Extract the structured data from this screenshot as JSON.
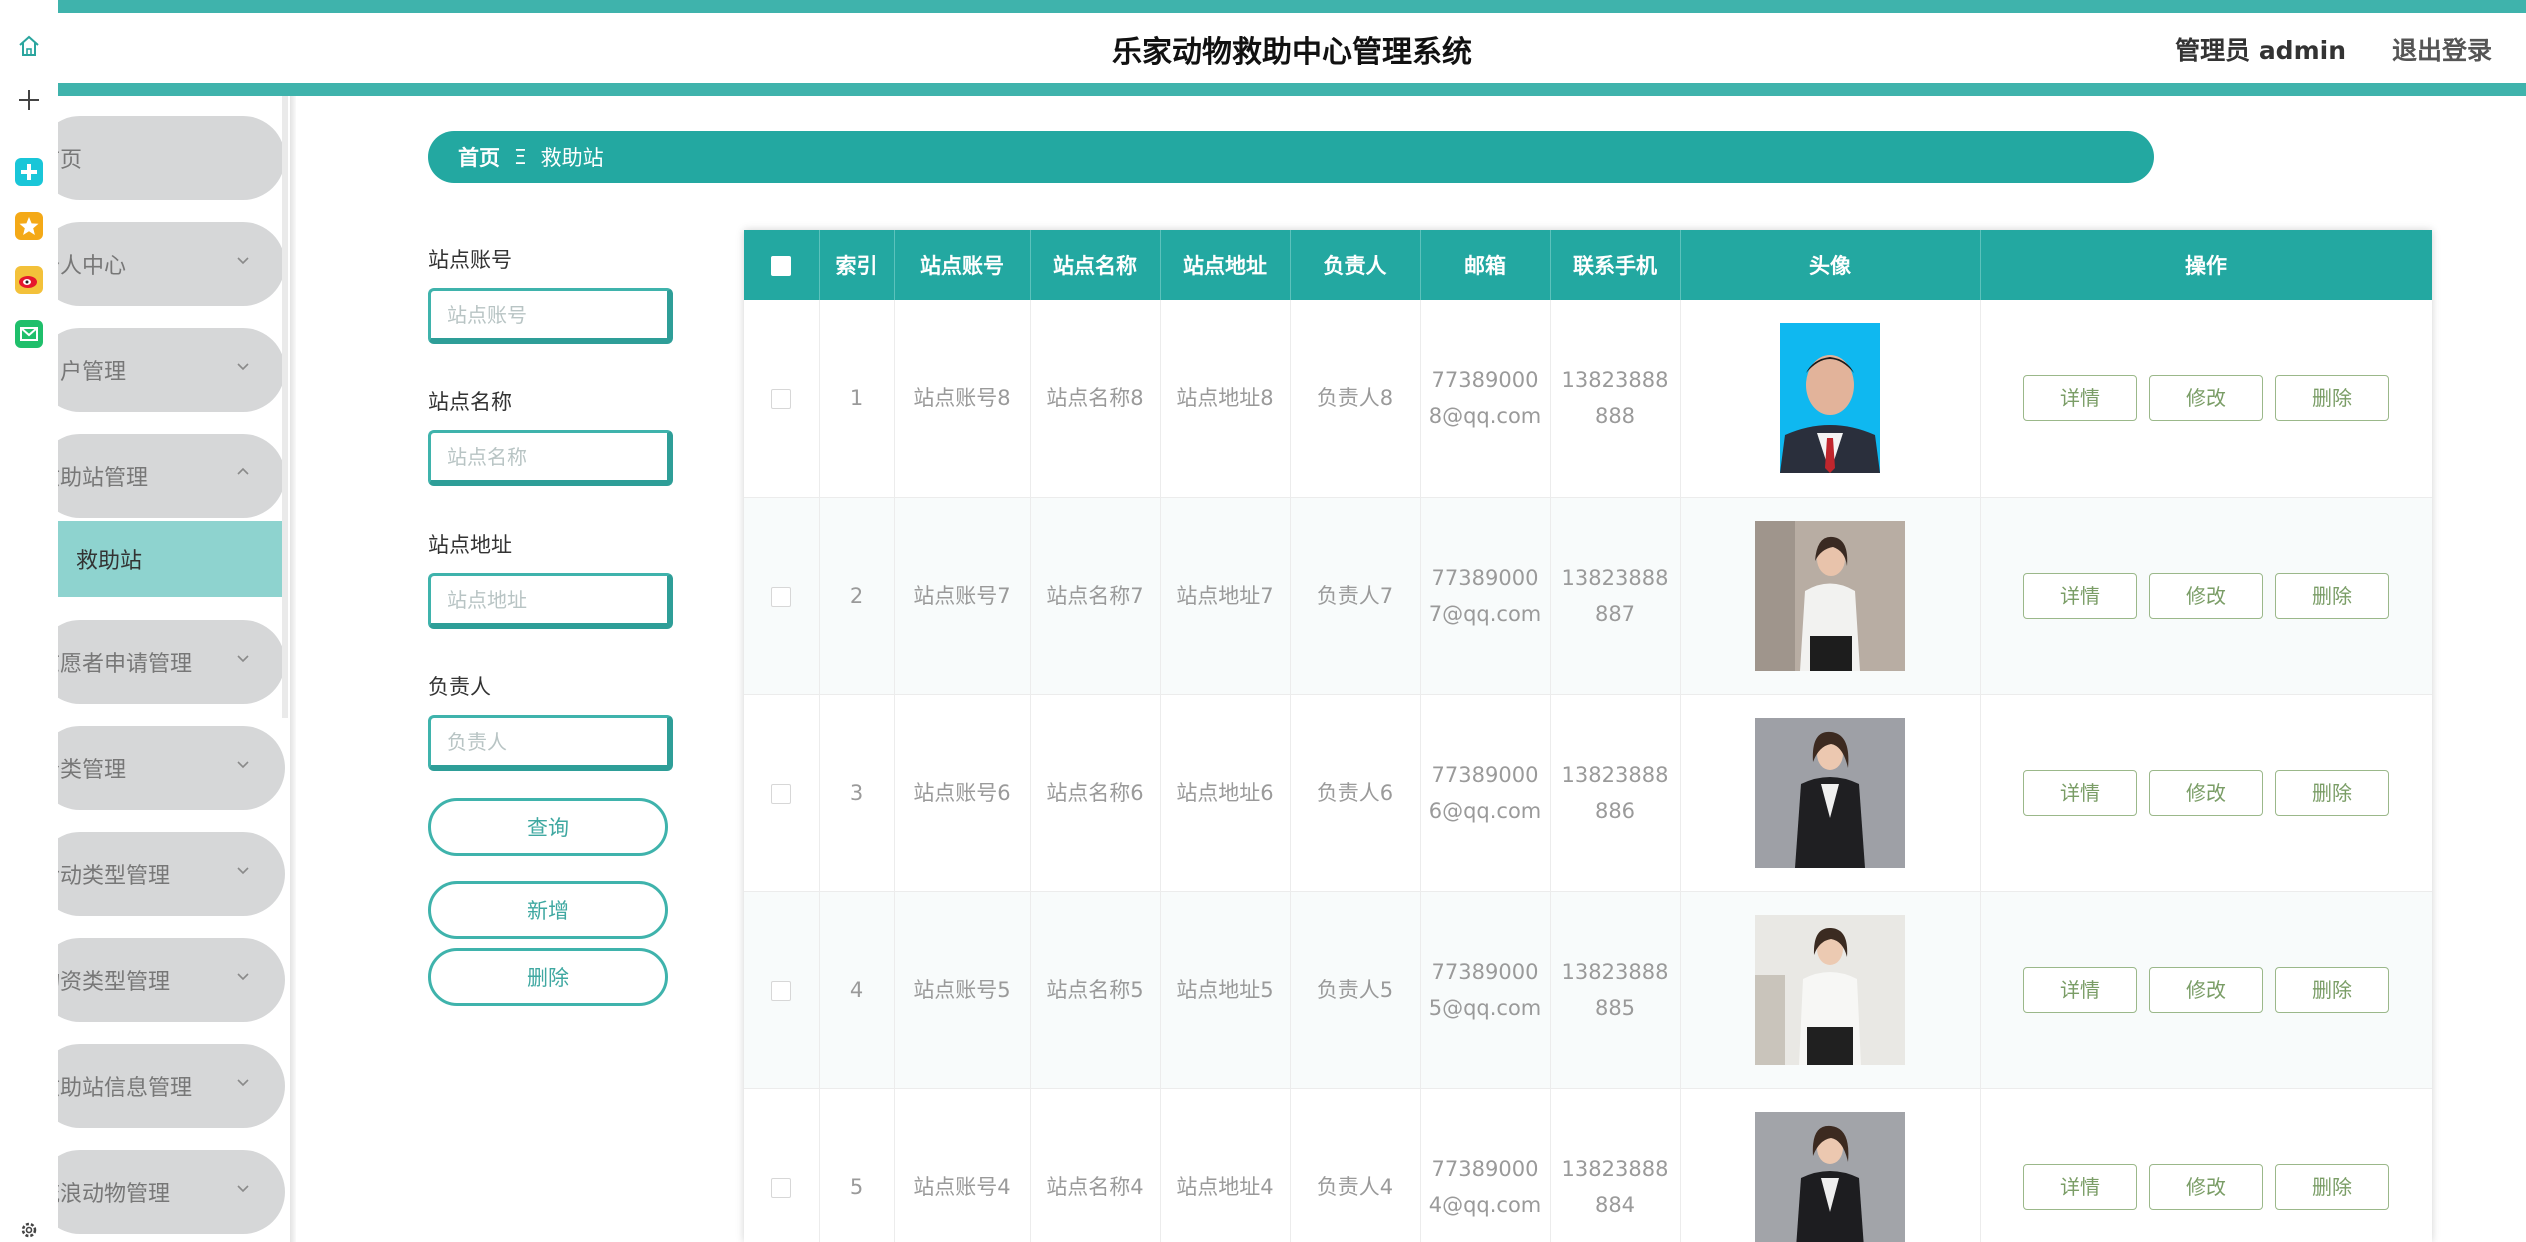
{
  "app": {
    "title": "乐家动物救助中心管理系统",
    "user_label": "管理员 admin",
    "logout_label": "退出登录"
  },
  "dock": [
    {
      "icon": "home-icon"
    },
    {
      "icon": "plus-icon"
    },
    {
      "icon": "health-app-icon"
    },
    {
      "icon": "star-app-icon"
    },
    {
      "icon": "weibo-app-icon"
    },
    {
      "icon": "mail-app-icon"
    },
    {
      "icon": "gear-icon"
    }
  ],
  "sidebar": {
    "items": [
      {
        "label": "首页"
      },
      {
        "label": "个人中心"
      },
      {
        "label": "用户管理"
      },
      {
        "label": "救助站管理"
      },
      {
        "label": "志愿者申请管理"
      },
      {
        "label": "分类管理"
      },
      {
        "label": "活动类型管理"
      },
      {
        "label": "物资类型管理"
      },
      {
        "label": "救助站信息管理"
      },
      {
        "label": "流浪动物管理"
      }
    ],
    "sub_item": "救助站"
  },
  "breadcrumb": {
    "home": "首页",
    "separator": "Ξ",
    "current": "救助站"
  },
  "search": {
    "fields": [
      {
        "label": "站点账号",
        "placeholder": "站点账号"
      },
      {
        "label": "站点名称",
        "placeholder": "站点名称"
      },
      {
        "label": "站点地址",
        "placeholder": "站点地址"
      },
      {
        "label": "负责人",
        "placeholder": "负责人"
      }
    ],
    "query_label": "查询",
    "add_label": "新增",
    "delete_label": "删除"
  },
  "table": {
    "columns": [
      "索引",
      "站点账号",
      "站点名称",
      "站点地址",
      "负责人",
      "邮箱",
      "联系手机",
      "头像",
      "操作"
    ],
    "actions": [
      "详情",
      "修改",
      "删除"
    ],
    "rows": [
      {
        "index": "1",
        "account": "站点账号8",
        "name": "站点名称8",
        "address": "站点地址8",
        "manager": "负责人8",
        "email": "773890008@qq.com",
        "phone": "13823888888"
      },
      {
        "index": "2",
        "account": "站点账号7",
        "name": "站点名称7",
        "address": "站点地址7",
        "manager": "负责人7",
        "email": "773890007@qq.com",
        "phone": "13823888887"
      },
      {
        "index": "3",
        "account": "站点账号6",
        "name": "站点名称6",
        "address": "站点地址6",
        "manager": "负责人6",
        "email": "773890006@qq.com",
        "phone": "13823888886"
      },
      {
        "index": "4",
        "account": "站点账号5",
        "name": "站点名称5",
        "address": "站点地址5",
        "manager": "负责人5",
        "email": "773890005@qq.com",
        "phone": "13823888885"
      },
      {
        "index": "5",
        "account": "站点账号4",
        "name": "站点名称4",
        "address": "站点地址4",
        "manager": "负责人4",
        "email": "773890004@qq.com",
        "phone": "13823888884"
      }
    ]
  },
  "colors": {
    "accent": "#23a8a1",
    "accent_light": "#8ed3cf",
    "menu_bg": "#d6d7d8",
    "action_border": "#9bb88a"
  }
}
